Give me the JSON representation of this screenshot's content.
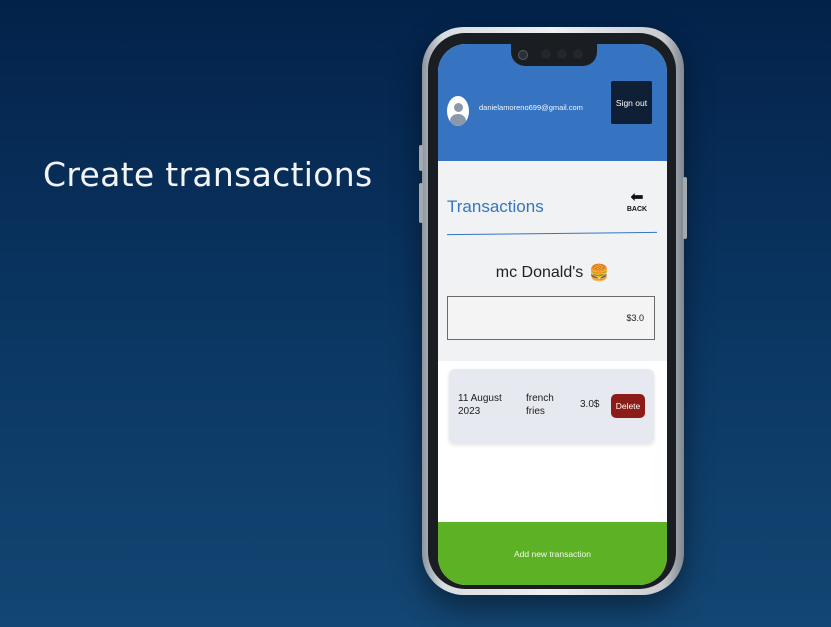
{
  "headline": "Create transactions",
  "app": {
    "header": {
      "email": "danielamoreno699@gmail.com",
      "signout_label": "Sign out"
    },
    "page_title": "Transactions",
    "back_label": "BACK",
    "back_icon": "arrow-left-icon",
    "store": {
      "name": "mc Donald's",
      "icon": "fastfood-icon"
    },
    "amount_field": {
      "value": "$3.0"
    },
    "transactions": [
      {
        "date": "11 August 2023",
        "description": "french fries",
        "amount": "3.0$",
        "delete_label": "Delete"
      }
    ],
    "add_button_label": "Add new transaction"
  },
  "colors": {
    "header": "#3674c1",
    "accent": "#3674c1",
    "delete": "#8c1c17",
    "add": "#5db124",
    "background": "#03224a"
  }
}
